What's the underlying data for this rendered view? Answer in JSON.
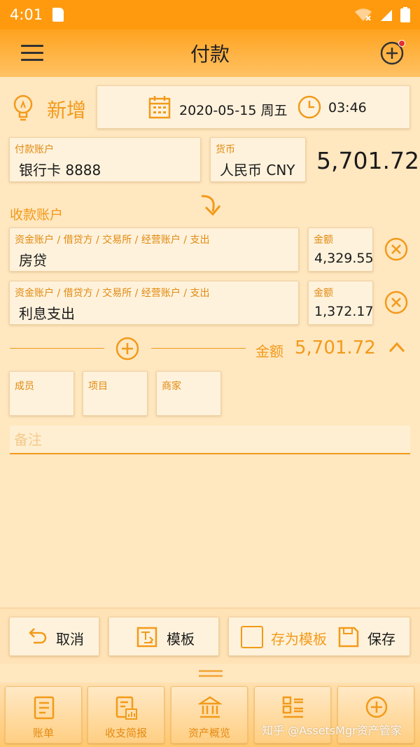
{
  "status_bar": {
    "time": "4:01"
  },
  "app_bar": {
    "title": "付款"
  },
  "mode": {
    "label": "新增"
  },
  "datetime": {
    "date": "2020-05-15 周五",
    "time": "03:46"
  },
  "payment": {
    "account_label": "付款账户",
    "account_value": "银行卡 8888",
    "currency_label": "货币",
    "currency_value": "人民币 CNY",
    "amount": "5,701.72"
  },
  "receive": {
    "label": "收款账户",
    "items": [
      {
        "path": "资金账户 / 借贷方 / 交易所 / 经营账户 / 支出",
        "name": "房贷",
        "amount_label": "金额",
        "amount": "4,329.55"
      },
      {
        "path": "资金账户 / 借贷方 / 交易所 / 经营账户 / 支出",
        "name": "利息支出",
        "amount_label": "金额",
        "amount": "1,372.17"
      }
    ]
  },
  "total": {
    "label": "金额",
    "value": "5,701.72"
  },
  "tags": [
    {
      "label": "成员"
    },
    {
      "label": "项目"
    },
    {
      "label": "商家"
    }
  ],
  "note": {
    "placeholder": "备注"
  },
  "actions": {
    "cancel": "取消",
    "template": "模板",
    "save_as_template": "存为模板",
    "save": "保存"
  },
  "bottom_nav": [
    {
      "label": "账单",
      "icon": "bill-icon"
    },
    {
      "label": "收支简报",
      "icon": "report-icon"
    },
    {
      "label": "资产概览",
      "icon": "bank-icon"
    },
    {
      "label": "",
      "icon": "grid-list-icon"
    },
    {
      "label": "",
      "icon": "add-circle-icon"
    }
  ],
  "watermark": "知乎 @AssetsMgr资产管家",
  "colors": {
    "accent": "#F29A1A",
    "status_bar": "#FF9A0E",
    "background": "#FFE7C0",
    "field": "#FFF2DC"
  }
}
